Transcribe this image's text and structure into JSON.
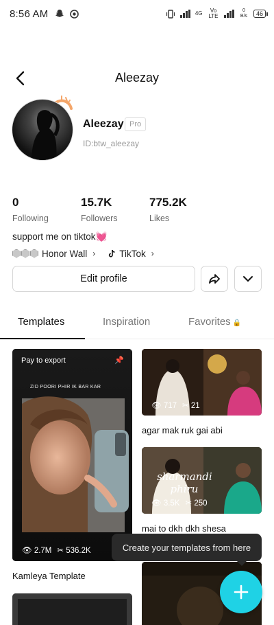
{
  "status_bar": {
    "time": "8:56 AM",
    "icons": [
      "snapchat-icon",
      "chrome-icon",
      "vibrate-icon",
      "signal-icon",
      "lte-icon",
      "wifi-icon",
      "battery-icon"
    ],
    "network_1": "4G",
    "network_2": "Vo LTE",
    "speed": "0 B/s",
    "battery": "46"
  },
  "header": {
    "title": "Aleezay"
  },
  "profile": {
    "name": "Aleezay",
    "badge": "Pro",
    "id": "ID:btw_aleezay",
    "bio_text": "support me on tiktok",
    "bio_emoji": "💓"
  },
  "stats": [
    {
      "value": "0",
      "label": "Following"
    },
    {
      "value": "15.7K",
      "label": "Followers"
    },
    {
      "value": "775.2K",
      "label": "Likes"
    }
  ],
  "links": {
    "honor_wall": "Honor Wall",
    "tiktok": "TikTok"
  },
  "actions": {
    "edit_profile": "Edit profile"
  },
  "tabs": [
    {
      "label": "Templates",
      "active": true
    },
    {
      "label": "Inspiration",
      "active": false
    },
    {
      "label": "Favorites",
      "active": false
    }
  ],
  "templates": {
    "left_card": {
      "pay_label": "Pay to export",
      "views": "2.7M",
      "uses": "536.2K",
      "caption": "Kamleya Template",
      "overlay_text": "ZID POORI PHIR IK BAR KAR"
    },
    "right_card_1": {
      "views": "717",
      "uses": "21",
      "caption": "agar mak ruk gai abi"
    },
    "right_card_2": {
      "views": "3.5K",
      "uses": "250",
      "caption": "mai to dkh dkh shesa",
      "overlay_text": "sharmandi phiru"
    }
  },
  "tooltip": {
    "text": "Create your templates from here"
  },
  "colors": {
    "accent": "#1fd2e5",
    "heart": "#ff5fa2"
  }
}
